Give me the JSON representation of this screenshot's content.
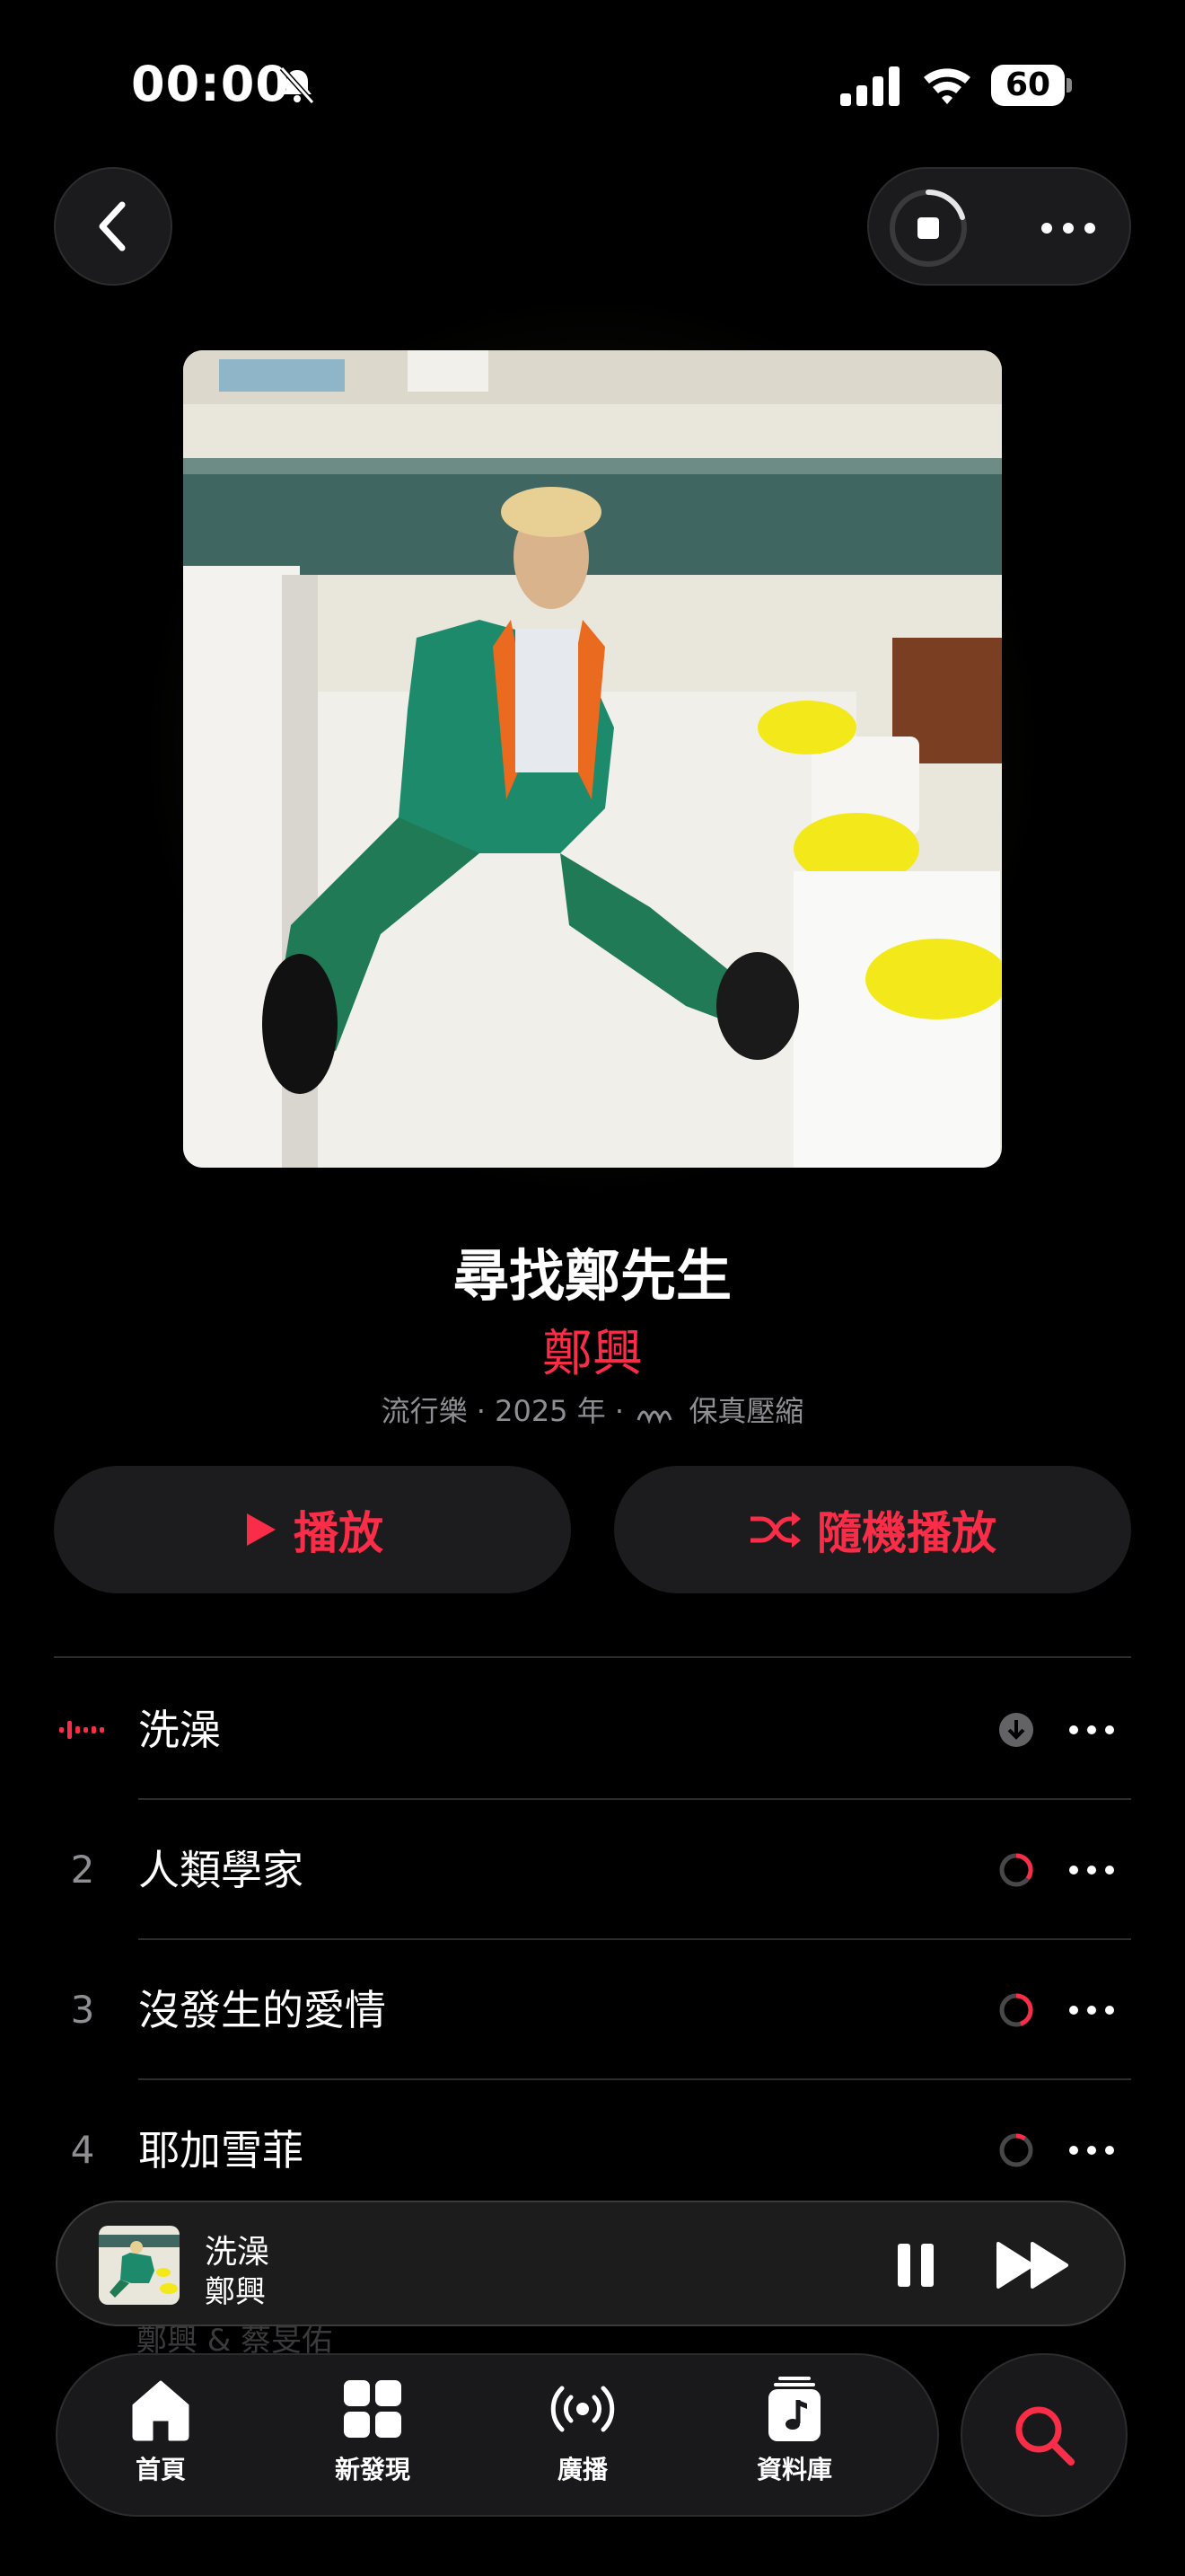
{
  "status_bar": {
    "time": "00:00",
    "battery": "60"
  },
  "album": {
    "title": "尋找鄭先生",
    "artist": "鄭興",
    "meta_prefix": "流行樂 · 2025 年 ·",
    "meta_suffix": "保真壓縮"
  },
  "actions": {
    "play_label": "播放",
    "shuffle_label": "隨機播放"
  },
  "tracks": [
    {
      "number": "",
      "title": "洗澡",
      "status": "downloaded",
      "playing": true
    },
    {
      "number": "2",
      "title": "人類學家",
      "status": "downloading",
      "download_progress": 0.35
    },
    {
      "number": "3",
      "title": "沒發生的愛情",
      "status": "downloading",
      "download_progress": 0.45
    },
    {
      "number": "4",
      "title": "耶加雪菲",
      "status": "downloading",
      "download_progress": 0.1
    }
  ],
  "mini_player": {
    "title": "洗澡",
    "artist": "鄭興"
  },
  "ghost_text": "鄭興 & 蔡旻佑",
  "tab_bar": {
    "tabs": [
      {
        "label": "首頁",
        "icon": "home-icon"
      },
      {
        "label": "新發現",
        "icon": "grid-icon"
      },
      {
        "label": "廣播",
        "icon": "radio-icon"
      },
      {
        "label": "資料庫",
        "icon": "library-icon"
      }
    ],
    "search_icon": "search-icon"
  },
  "colors": {
    "accent": "#fa2d48",
    "background": "#000000",
    "surface": "#1c1c1e",
    "secondary_text": "#8e8e93"
  }
}
